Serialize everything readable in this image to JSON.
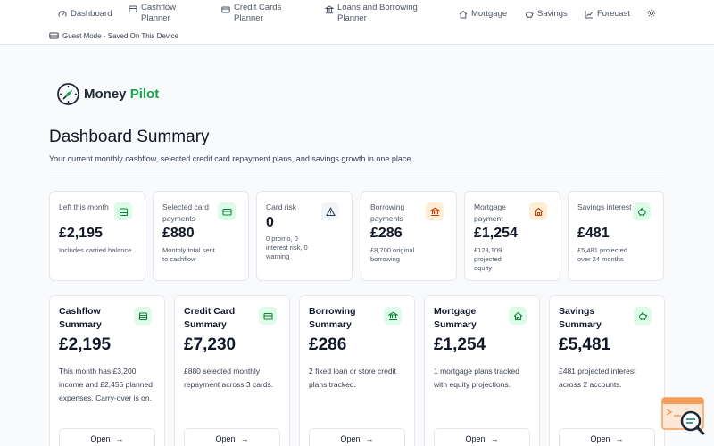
{
  "nav": {
    "dashboard": "Dashboard",
    "cashflow": "Cashflow Planner",
    "credit_cards": "Credit Cards Planner",
    "loans": "Loans and Borrowing Planner",
    "mortgage": "Mortgage",
    "savings": "Savings",
    "forecast": "Forecast",
    "settings_icon": "gear-icon"
  },
  "guest_mode": "Guest Mode - Saved On This Device",
  "brand": {
    "name_part1": "Money ",
    "name_part2": "Pilot"
  },
  "page": {
    "title": "Dashboard Summary",
    "subtitle": "Your current monthly cashflow, selected credit card repayment plans, and savings growth in one place."
  },
  "kpis": [
    {
      "label": "Left this month",
      "value": "£2,195",
      "note": "Includes carried balance",
      "icon": "wallet-icon"
    },
    {
      "label": "Selected card payments",
      "value": "£880",
      "note": "Monthly total sent to cashflow",
      "icon": "credit-card-icon"
    },
    {
      "label": "Card risk",
      "value": "0",
      "note": "0 promo, 0 interest risk, 0 warning",
      "icon": "warning-icon"
    },
    {
      "label": "Borrowing payments",
      "value": "£286",
      "note": "£8,700 original borrowing",
      "icon": "bank-icon"
    },
    {
      "label": "Mortgage payment",
      "value": "£1,254",
      "note": "£128,109 projected equity",
      "icon": "home-icon"
    },
    {
      "label": "Savings interest",
      "value": "£481",
      "note": "£5,481 projected over 24 months",
      "icon": "piggy-bank-icon"
    }
  ],
  "summaries": [
    {
      "title": "Cashflow Summary",
      "value": "£2,195",
      "desc": "This month has £3,200 income and £2,455 planned expenses. Carry-over is on.",
      "button": "Open",
      "icon": "wallet-icon"
    },
    {
      "title": "Credit Card Summary",
      "value": "£7,230",
      "desc": "£880 selected monthly repayment across 3 cards.",
      "button": "Open",
      "icon": "credit-card-icon"
    },
    {
      "title": "Borrowing Summary",
      "value": "£286",
      "desc": "2 fixed loan or store credit plans tracked.",
      "button": "Open",
      "icon": "bank-icon"
    },
    {
      "title": "Mortgage Summary",
      "value": "£1,254",
      "desc": "1 mortgage plans tracked with equity projections.",
      "button": "Open",
      "icon": "home-icon"
    },
    {
      "title": "Savings Summary",
      "value": "£5,481",
      "desc": "£481 projected interest across 2 accounts.",
      "button": "Open",
      "icon": "piggy-bank-icon"
    }
  ],
  "colors": {
    "brand_green": "#16a34a",
    "badge_green_bg": "#dcfce7",
    "badge_orange_bg": "#ffedd5",
    "badge_gray_bg": "#f1f5f9"
  }
}
